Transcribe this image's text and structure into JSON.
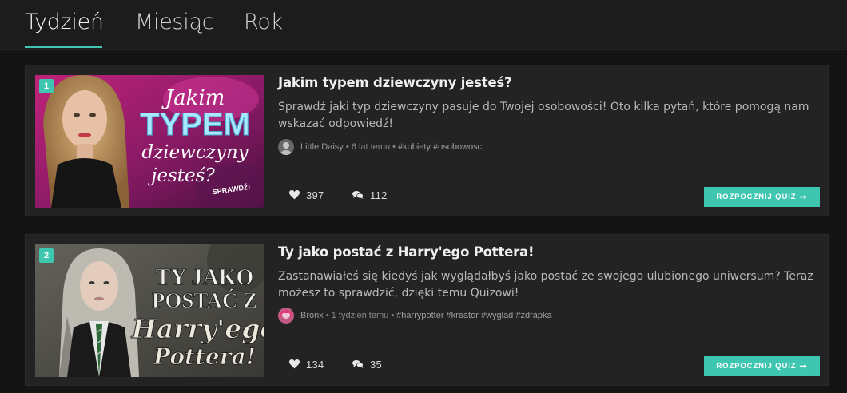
{
  "tabs": [
    {
      "label": "Tydzień",
      "active": true
    },
    {
      "label": "Miesiąc",
      "active": false
    },
    {
      "label": "Rok",
      "active": false
    }
  ],
  "quizzes": [
    {
      "rank": "1",
      "title": "Jakim typem dziewczyny jesteś?",
      "description": "Sprawdź jaki typ dziewczyny pasuje do Twojej osobowości! Oto kilka pytań, które pomogą nam wskazać odpowiedź!",
      "author": "Little.Daisy",
      "time": "• 6 lat temu •",
      "tags": "#kobiety #osobowosc",
      "likes": "397",
      "comments": "112",
      "cta": "ROZPOCZNIJ QUIZ",
      "thumb_text": [
        "Jakim",
        "TYPEM",
        "dziewczyny",
        "jesteś?",
        "SPRAWDŹ!"
      ]
    },
    {
      "rank": "2",
      "title": "Ty jako postać z Harry'ego Pottera!",
      "description": "Zastanawiałeś się kiedyś jak wyglądałbyś jako postać ze swojego ulubionego uniwersum? Teraz możesz to sprawdzić, dzięki temu Quizowi!",
      "author": "Bronx",
      "time": "• 1 tydzień temu •",
      "tags": "#harrypotter #kreator #wyglad #zdrapka",
      "likes": "134",
      "comments": "35",
      "cta": "ROZPOCZNIJ QUIZ",
      "thumb_text": [
        "TY JAKO",
        "POSTAĆ Z",
        "Harry'ego",
        "Pottera!"
      ]
    }
  ],
  "colors": {
    "accent": "#3ec6b0",
    "card": "#232323",
    "background": "#141414"
  }
}
